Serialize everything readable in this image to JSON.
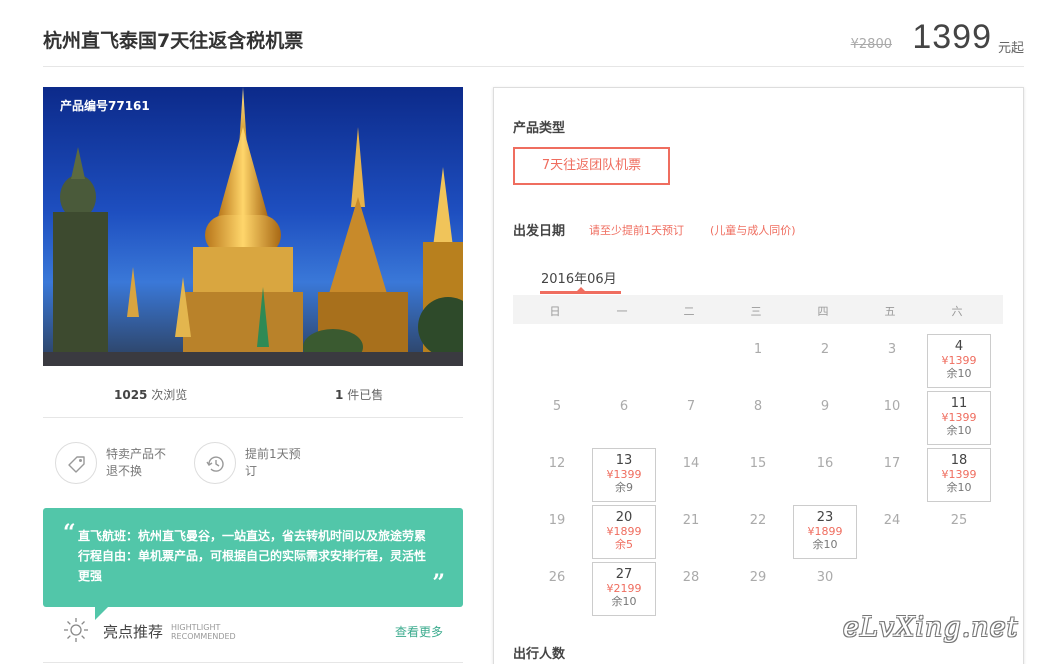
{
  "header": {
    "title": "杭州直飞泰国7天往返含税机票",
    "original_price": "¥2800",
    "price": "1399",
    "price_suffix": "元起"
  },
  "product": {
    "code_label": "产品编号77161",
    "views_count": "1025",
    "views_label": "次浏览",
    "sold_count": "1",
    "sold_label": "件已售"
  },
  "features": [
    {
      "icon": "tag-icon",
      "text": "特卖产品不退不换"
    },
    {
      "icon": "clock-icon",
      "text": "提前1天预订"
    }
  ],
  "quote": {
    "lines": [
      "直飞航班：杭州直飞曼谷，一站直达，省去转机时间以及旅途劳累",
      "行程自由：单机票产品，可根据自己的实际需求安排行程，灵活性",
      "更强"
    ]
  },
  "highlight": {
    "title": "亮点推荐",
    "en_line1": "HIGHTLIGHT",
    "en_line2": "RECOMMENDED",
    "more": "查看更多"
  },
  "booking": {
    "type_label": "产品类型",
    "type_option": "7天往返团队机票",
    "date_label": "出发日期",
    "date_note": "请至少提前1天预订",
    "date_note2": "(儿童与成人同价)",
    "month": "2016年06月",
    "people_label": "出行人数",
    "weekdays": [
      "日",
      "一",
      "二",
      "三",
      "四",
      "五",
      "六"
    ],
    "weeks": [
      [
        {
          "d": ""
        },
        {
          "d": ""
        },
        {
          "d": ""
        },
        {
          "d": "1"
        },
        {
          "d": "2"
        },
        {
          "d": "3"
        },
        {
          "d": "4",
          "p": "¥1399",
          "s": "余10"
        }
      ],
      [
        {
          "d": "5"
        },
        {
          "d": "6"
        },
        {
          "d": "7"
        },
        {
          "d": "8"
        },
        {
          "d": "9"
        },
        {
          "d": "10"
        },
        {
          "d": "11",
          "p": "¥1399",
          "s": "余10"
        }
      ],
      [
        {
          "d": "12"
        },
        {
          "d": "13",
          "p": "¥1399",
          "s": "余9"
        },
        {
          "d": "14"
        },
        {
          "d": "15"
        },
        {
          "d": "16"
        },
        {
          "d": "17"
        },
        {
          "d": "18",
          "p": "¥1399",
          "s": "余10"
        }
      ],
      [
        {
          "d": "19"
        },
        {
          "d": "20",
          "p": "¥1899",
          "s": "余5",
          "low": true
        },
        {
          "d": "21"
        },
        {
          "d": "22"
        },
        {
          "d": "23",
          "p": "¥1899",
          "s": "余10"
        },
        {
          "d": "24"
        },
        {
          "d": "25"
        }
      ],
      [
        {
          "d": "26"
        },
        {
          "d": "27",
          "p": "¥2199",
          "s": "余10"
        },
        {
          "d": "28"
        },
        {
          "d": "29"
        },
        {
          "d": "30"
        },
        {
          "d": ""
        },
        {
          "d": ""
        }
      ]
    ]
  },
  "watermark": "eLvXing.net",
  "colors": {
    "accent": "#ef6d5f",
    "teal": "#52c6a9",
    "link_green": "#3bab8e"
  }
}
